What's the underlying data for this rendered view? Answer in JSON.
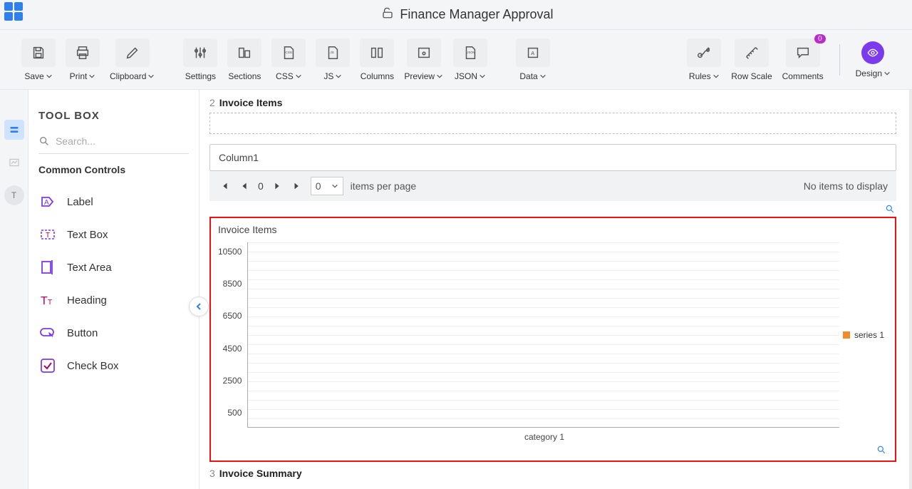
{
  "header": {
    "title": "Finance Manager Approval",
    "lock_state": "unlocked"
  },
  "toolbar": {
    "save": "Save",
    "print": "Print",
    "clipboard": "Clipboard",
    "settings": "Settings",
    "sections": "Sections",
    "css": "CSS",
    "js": "JS",
    "columns": "Columns",
    "preview": "Preview",
    "json": "JSON",
    "data": "Data",
    "rules": "Rules",
    "row_scale": "Row Scale",
    "comments": "Comments",
    "comments_badge": "0",
    "design": "Design"
  },
  "panel": {
    "title": "TOOL BOX",
    "search_placeholder": "Search...",
    "common_heading": "Common Controls",
    "items": [
      {
        "label": "Label"
      },
      {
        "label": "Text Box"
      },
      {
        "label": "Text Area"
      },
      {
        "label": "Heading"
      },
      {
        "label": "Button"
      },
      {
        "label": "Check Box"
      }
    ]
  },
  "rail": {
    "tab3_label": "T"
  },
  "section2": {
    "num": "2",
    "title": "Invoice Items",
    "column_label": "Column1",
    "pager": {
      "page": "0",
      "per_page": "0",
      "per_page_label": "items per page",
      "empty_msg": "No items to display"
    }
  },
  "section3": {
    "num": "3",
    "title": "Invoice Summary"
  },
  "chart_title": "Invoice Items",
  "chart_data": {
    "type": "bar",
    "title": "Invoice Items",
    "categories": [
      "category 1"
    ],
    "series": [
      {
        "name": "series 1",
        "values": [
          null
        ],
        "color": "#f38b2b"
      }
    ],
    "y_ticks": [
      "10500",
      "8500",
      "6500",
      "4500",
      "2500",
      "500"
    ],
    "ylim": [
      500,
      10500
    ],
    "xlabel": "",
    "ylabel": "",
    "legend": {
      "position": "right"
    }
  }
}
